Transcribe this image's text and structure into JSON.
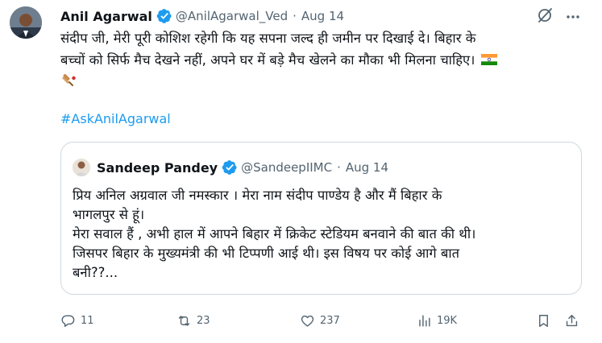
{
  "tweet": {
    "author_name": "Anil Agarwal",
    "handle": "@AnilAgarwal_Ved",
    "separator": "·",
    "date": "Aug 14",
    "text_line1": "संदीप जी, मेरी पूरी कोशिश रहेगी कि यह सपना जल्द ही जमीन पर दिखाई दे। बिहार के",
    "text_line2": "बच्चों को सिर्फ मैच देखने नहीं, अपने घर में बड़े मैच खेलने का मौका भी मिलना चाहिए।",
    "hashtag": "#AskAnilAgarwal"
  },
  "quoted_tweet": {
    "author_name": "Sandeep Pandey",
    "handle": "@SandeepIIMC",
    "separator": "·",
    "date": "Aug 14",
    "line1": "प्रिय अनिल अग्रवाल जी नमस्कार । मेरा नाम संदीप पाण्डेय है और मैं बिहार के",
    "line2": "भागलपुर से हूं।",
    "line3": "मेरा सवाल हैं , अभी हाल में आपने बिहार में क्रिकेट स्टेडियम बनवाने की बात की थी।",
    "line4": "जिसपर बिहार के मुख्यमंत्री की भी टिप्पणी आई थी। इस विषय पर कोई आगे बात",
    "line5": "बनी??..."
  },
  "actions": {
    "replies": "11",
    "retweets": "23",
    "likes": "237",
    "views": "19K"
  },
  "colors": {
    "accent": "#1d9bf0",
    "secondary_text": "#536471",
    "border": "#cfd9de"
  },
  "icons": [
    "verified-badge-icon",
    "grok-icon",
    "more-icon",
    "india-flag-icon",
    "cricket-bat-icon",
    "reply-icon",
    "retweet-icon",
    "like-icon",
    "views-icon",
    "bookmark-icon",
    "share-icon"
  ]
}
